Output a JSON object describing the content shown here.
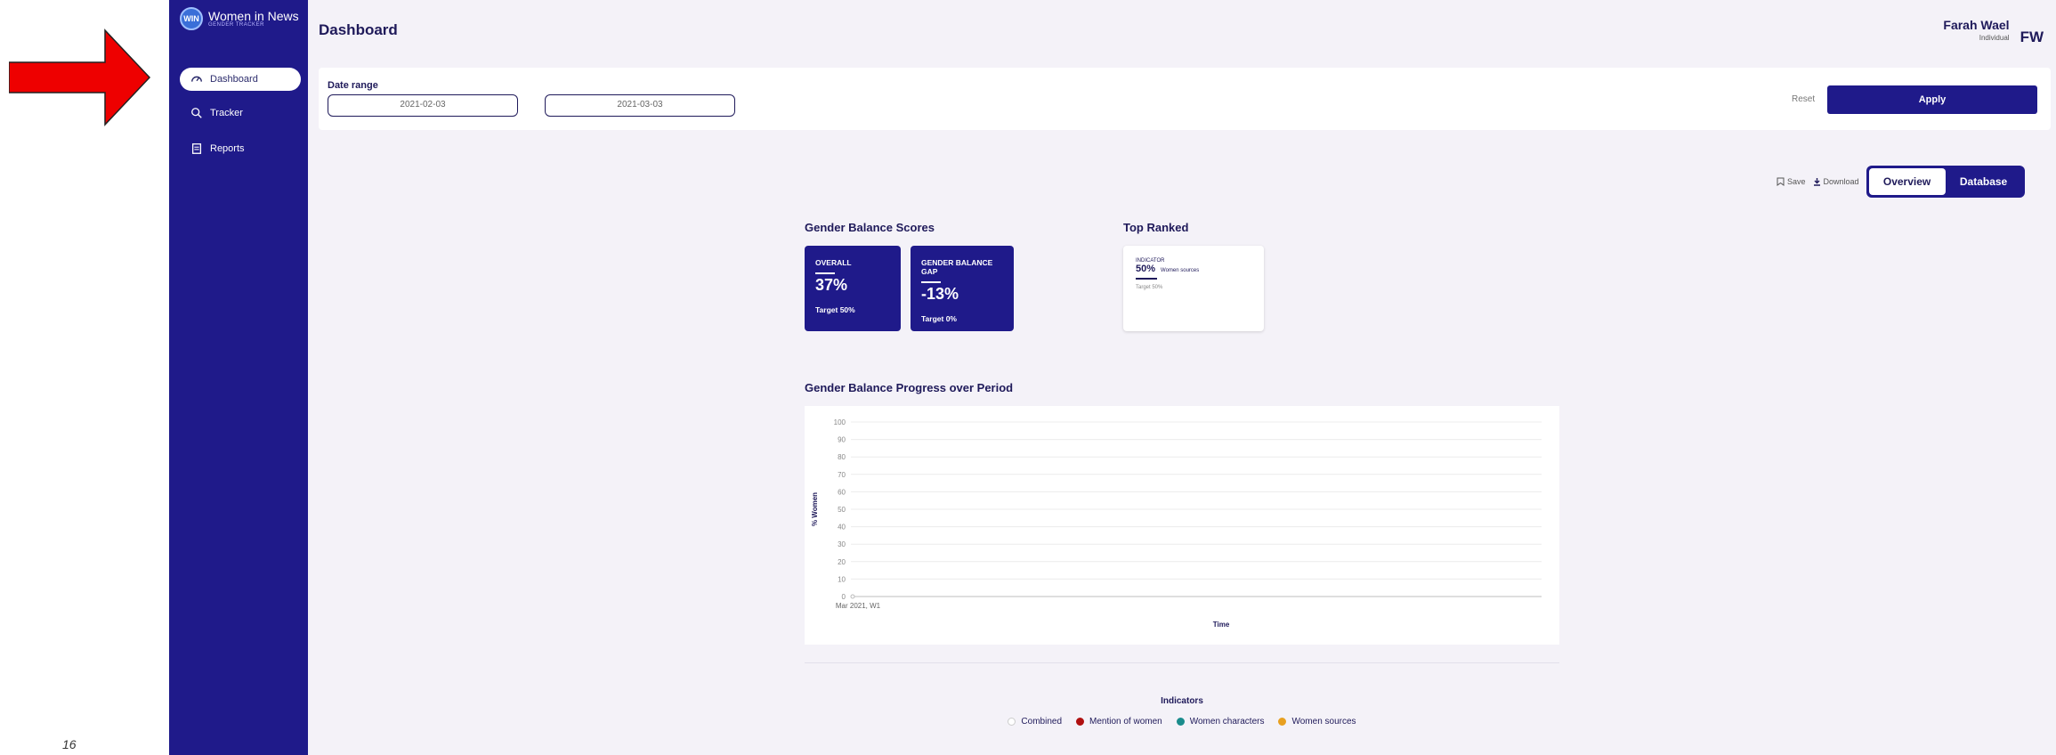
{
  "annotation": {
    "page_number": "16"
  },
  "app": {
    "logo_title": "Women in News",
    "logo_subtitle": "GENDER TRACKER",
    "logo_badge": "WIN"
  },
  "sidebar": {
    "items": [
      {
        "label": "Dashboard",
        "icon": "gauge-icon",
        "active": true
      },
      {
        "label": "Tracker",
        "icon": "magnifier-icon",
        "active": false
      },
      {
        "label": "Reports",
        "icon": "document-icon",
        "active": false
      }
    ]
  },
  "header": {
    "title": "Dashboard",
    "user_name": "Farah Wael",
    "user_role": "Individual",
    "user_initials": "FW"
  },
  "filters": {
    "date_range_label": "Date range",
    "start_date": "2021-02-03",
    "end_date": "2021-03-03",
    "reset_label": "Reset",
    "apply_label": "Apply"
  },
  "toolbar": {
    "save_label": "Save",
    "download_label": "Download",
    "overview_label": "Overview",
    "database_label": "Database",
    "active_view": "Overview"
  },
  "scores": {
    "title": "Gender Balance Scores",
    "overall": {
      "label": "OVERALL",
      "value": "37%",
      "target": "Target 50%"
    },
    "gap": {
      "label": "GENDER BALANCE GAP",
      "value": "-13%",
      "target": "Target 0%"
    }
  },
  "top_ranked": {
    "title": "Top Ranked",
    "label": "INDICATOR",
    "value": "50%",
    "indicator": "Women sources",
    "target": "Target 50%"
  },
  "progress": {
    "title": "Gender Balance Progress over Period"
  },
  "chart_data": {
    "type": "line",
    "ylabel": "% Women",
    "xlabel": "Time",
    "ylim": [
      0,
      100
    ],
    "yticks": [
      100,
      90,
      80,
      70,
      60,
      50,
      40,
      30,
      20,
      10,
      0
    ],
    "categories": [
      "Mar 2021, W1"
    ],
    "series": [
      {
        "name": "Combined",
        "values": [
          0
        ]
      }
    ],
    "grid": true
  },
  "legend": {
    "title": "Indicators",
    "items": [
      {
        "label": "Combined",
        "color": "#ffffff",
        "border": "#cccccc"
      },
      {
        "label": "Mention of women",
        "color": "#b01010",
        "border": "#b01010"
      },
      {
        "label": "Women characters",
        "color": "#1a8c8c",
        "border": "#1a8c8c"
      },
      {
        "label": "Women sources",
        "color": "#e8a020",
        "border": "#e8a020"
      }
    ]
  },
  "colors": {
    "sidebar": "#1f1a8a",
    "accent": "#1f1a8a",
    "annotation_arrow": "#ee0000"
  }
}
